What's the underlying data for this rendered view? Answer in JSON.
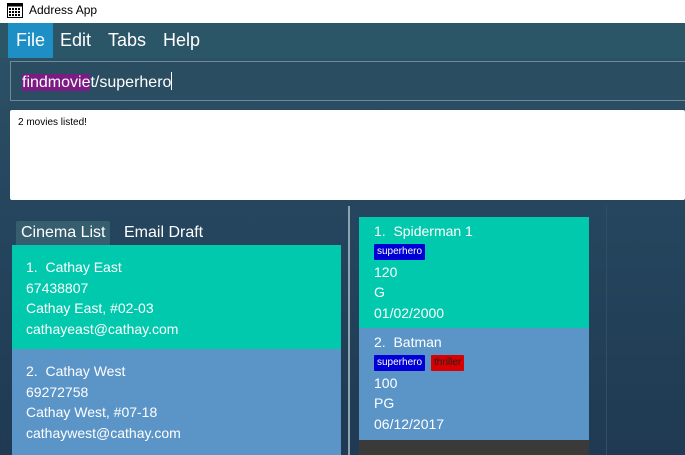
{
  "window": {
    "title": "Address App"
  },
  "menu": [
    "File",
    "Edit",
    "Tabs",
    "Help"
  ],
  "command": {
    "highlighted": "findmovie",
    "rest": "t/superhero"
  },
  "result": {
    "message": "2 movies listed!"
  },
  "tabs": {
    "cinema_list": "Cinema List",
    "email_draft": "Email Draft"
  },
  "cinemas": [
    {
      "index": "1.",
      "name": "Cathay East",
      "phone": "67438807",
      "address": "Cathay East, #02-03",
      "email": "cathayeast@cathay.com"
    },
    {
      "index": "2.",
      "name": "Cathay West",
      "phone": "69272758",
      "address": "Cathay West, #07-18",
      "email": "cathaywest@cathay.com"
    }
  ],
  "movies": [
    {
      "index": "1.",
      "title": "Spiderman 1",
      "tags": [
        "superhero"
      ],
      "duration": "120",
      "rating": "G",
      "date": "01/02/2000"
    },
    {
      "index": "2.",
      "title": "Batman",
      "tags": [
        "superhero",
        "thriller"
      ],
      "duration": "100",
      "rating": "PG",
      "date": "06/12/2017"
    }
  ],
  "colors": {
    "accent": "#1e8fc4",
    "card_teal": "#00c9ad",
    "card_blue": "#5b95c8",
    "highlight": "#7b1b83",
    "tag_blue": "#0000d6",
    "tag_red": "#d80000"
  }
}
